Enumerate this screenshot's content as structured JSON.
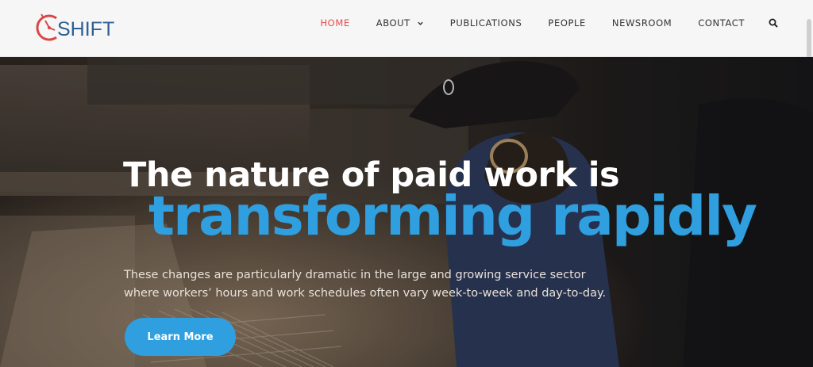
{
  "brand": {
    "logo_text": "SHIFT"
  },
  "nav": {
    "home": "HOME",
    "about": "ABOUT",
    "publications": "PUBLICATIONS",
    "people": "PEOPLE",
    "newsroom": "NEWSROOM",
    "contact": "CONTACT",
    "search_icon": "search-icon",
    "dropdown_icon": "chevron-down-icon"
  },
  "hero": {
    "headline_line1": "The nature of paid work is",
    "headline_line2": "transforming rapidly",
    "body": "These changes are particularly dramatic in the large and growing service sector where workers’ hours and work schedules often vary week-to-week and day-to-day.",
    "cta_label": "Learn More"
  },
  "colors": {
    "accent_blue": "#2f9fe0",
    "active_red": "#e64a4a",
    "logo_blue": "#2d5f93",
    "logo_red": "#d94848"
  }
}
